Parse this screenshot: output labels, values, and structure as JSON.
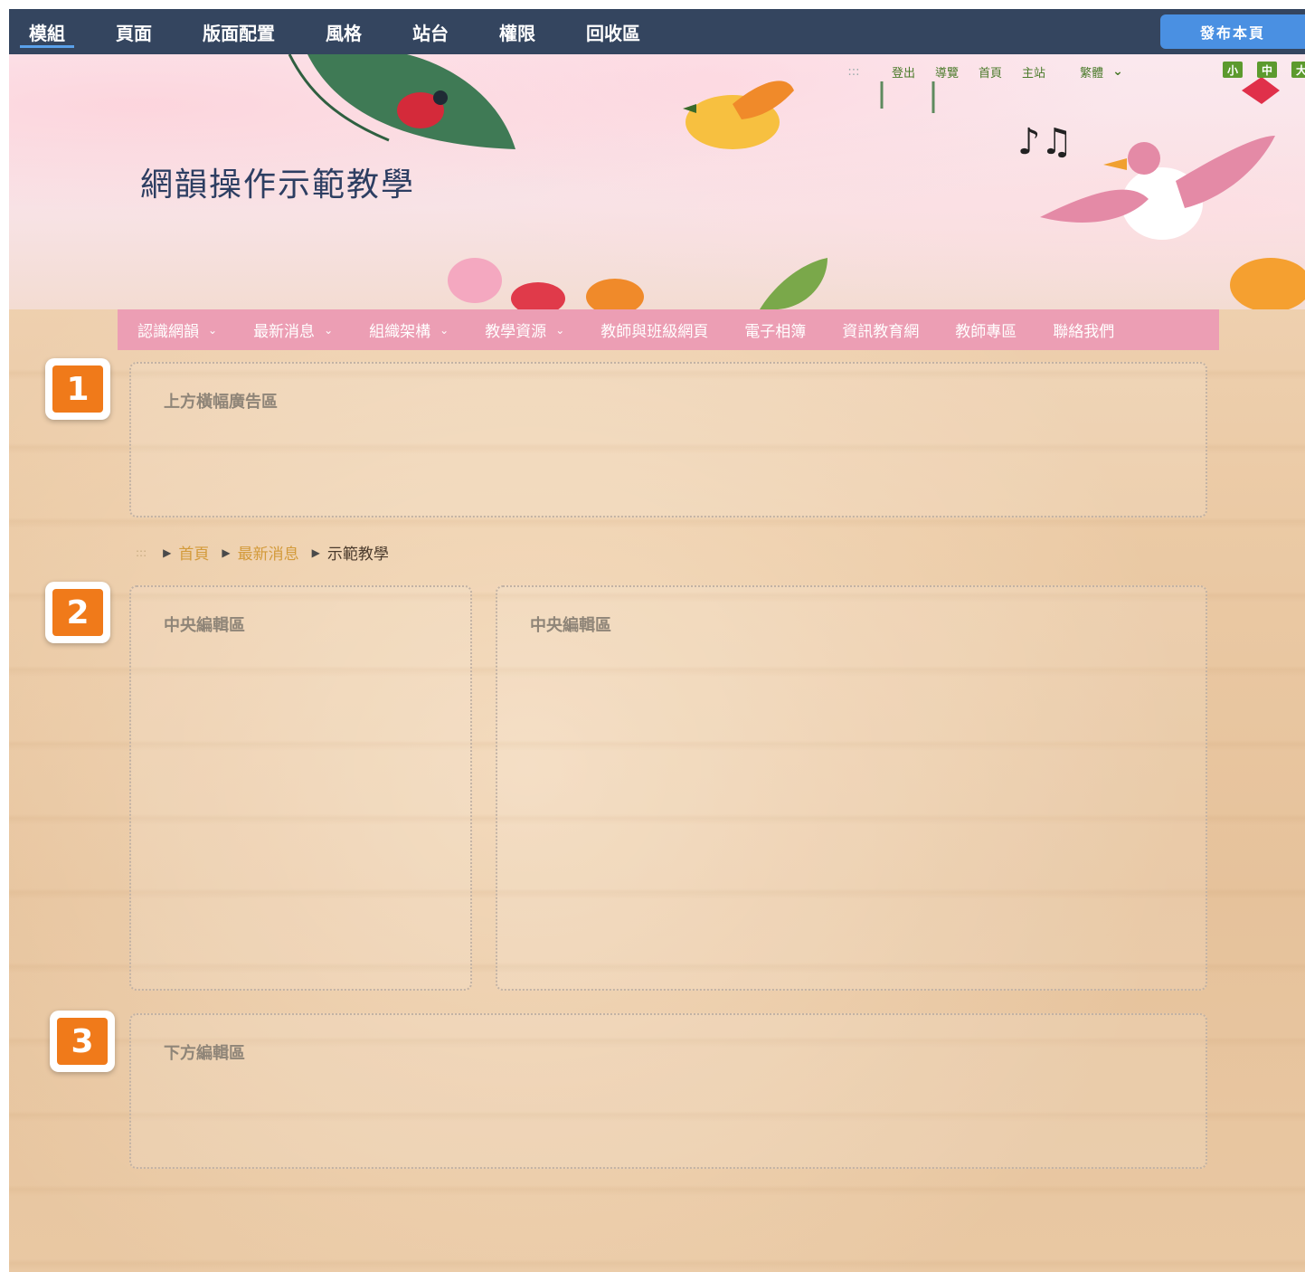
{
  "admin_tabs": [
    "模組",
    "頁面",
    "版面配置",
    "風格",
    "站台",
    "權限",
    "回收區"
  ],
  "publish_label": "發布本頁",
  "site_title": "網韻操作示範教學",
  "toplinks": {
    "dots": ":::",
    "logout": "登出",
    "guide": "導覽",
    "home": "首頁",
    "main_site": "主站",
    "language": "繁體"
  },
  "font_size": [
    "小",
    "中",
    "大"
  ],
  "nav": [
    {
      "label": "認識網韻",
      "has_dropdown": true
    },
    {
      "label": "最新消息",
      "has_dropdown": true
    },
    {
      "label": "組織架構",
      "has_dropdown": true
    },
    {
      "label": "教學資源",
      "has_dropdown": true
    },
    {
      "label": "教師與班級網頁",
      "has_dropdown": false
    },
    {
      "label": "電子相簿",
      "has_dropdown": false
    },
    {
      "label": "資訊教育網",
      "has_dropdown": false
    },
    {
      "label": "教師專區",
      "has_dropdown": false
    },
    {
      "label": "聯絡我們",
      "has_dropdown": false
    }
  ],
  "zones": {
    "top_banner": "上方橫幅廣告區",
    "center_left": "中央編輯區",
    "center_right": "中央編輯區",
    "bottom": "下方編輯區"
  },
  "badges": [
    "1",
    "2",
    "3"
  ],
  "breadcrumb": {
    "dots": ":::",
    "items": [
      "首頁",
      "最新消息",
      "示範教學"
    ]
  },
  "colors": {
    "adminbar": "#34455f",
    "publish": "#4a90e2",
    "nav": "#ec9eb4",
    "badge": "#f07a1a",
    "title": "#2d3e62"
  }
}
